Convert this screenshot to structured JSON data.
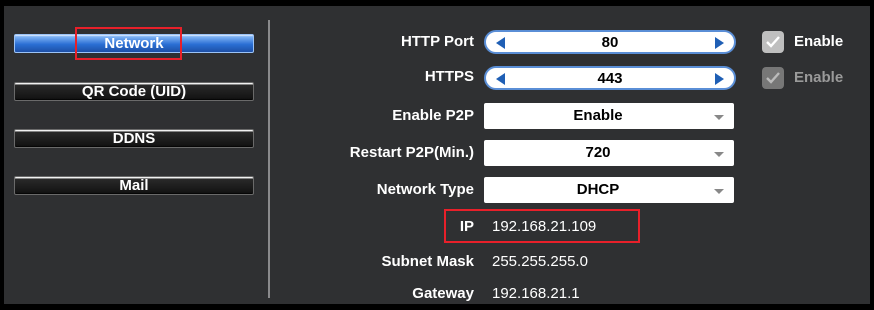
{
  "sidebar": {
    "items": [
      {
        "label": "Network",
        "active": true
      },
      {
        "label": "QR Code (UID)",
        "active": false
      },
      {
        "label": "DDNS",
        "active": false
      },
      {
        "label": "Mail",
        "active": false
      }
    ]
  },
  "form": {
    "http_port": {
      "label": "HTTP Port",
      "value": "80",
      "enable_label": "Enable",
      "enabled": true
    },
    "https": {
      "label": "HTTPS",
      "value": "443",
      "enable_label": "Enable",
      "enabled": false
    },
    "enable_p2p": {
      "label": "Enable P2P",
      "value": "Enable"
    },
    "restart_p2p": {
      "label": "Restart P2P(Min.)",
      "value": "720"
    },
    "network_type": {
      "label": "Network Type",
      "value": "DHCP"
    },
    "ip": {
      "label": "IP",
      "value": "192.168.21.109"
    },
    "subnet_mask": {
      "label": "Subnet Mask",
      "value": "255.255.255.0"
    },
    "gateway": {
      "label": "Gateway",
      "value": "192.168.21.1"
    }
  },
  "colors": {
    "highlight": "#e8202a",
    "active_tab": "#2a6fd4",
    "panel": "#2f3032"
  },
  "icons": {
    "check": "check-icon",
    "spinner_left": "arrow-left-icon",
    "spinner_right": "arrow-right-icon",
    "dropdown": "chevron-down-icon"
  }
}
